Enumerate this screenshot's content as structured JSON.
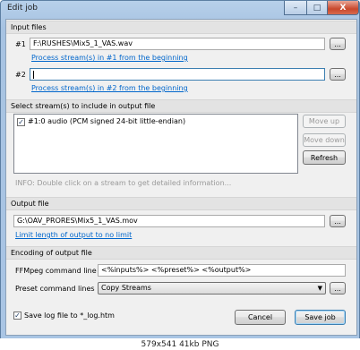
{
  "window": {
    "title": "Edit job",
    "controls": [
      "–",
      "□",
      "X"
    ]
  },
  "input_files": {
    "header": "Input files",
    "rows": [
      {
        "label": "#1",
        "value": "F:\\RUSHES\\Mix5_1_VAS.wav",
        "browse": "...",
        "link": "Process stream(s) in #1 from the beginning"
      },
      {
        "label": "#2",
        "value": "",
        "browse": "...",
        "link": "Process stream(s) in #2 from the beginning"
      }
    ]
  },
  "streams": {
    "header": "Select stream(s) to include in output file",
    "items": [
      {
        "label": "#1:0 audio (PCM signed 24-bit little-endian)",
        "checked": true
      }
    ],
    "move_up": "Move up",
    "move_down": "Move down",
    "refresh": "Refresh",
    "info": "INFO: Double click on a stream to get detailed information..."
  },
  "output": {
    "header": "Output file",
    "value": "G:\\OAV_PRORES\\Mix5_1_VAS.mov",
    "browse": "...",
    "link": "Limit length of output to no limit"
  },
  "encoding": {
    "header": "Encoding of output file",
    "ffmpeg_label": "FFMpeg command line",
    "ffmpeg_value": "<%inputs%> <%preset%> <%output%>",
    "preset_label": "Preset command lines",
    "preset_value": "Copy Streams",
    "preset_browse": "..."
  },
  "footer": {
    "save_log_label": "Save log file to *_log.htm",
    "save_log_checked": true,
    "cancel": "Cancel",
    "save": "Save job"
  },
  "image_caption": "579x541 41kb PNG"
}
